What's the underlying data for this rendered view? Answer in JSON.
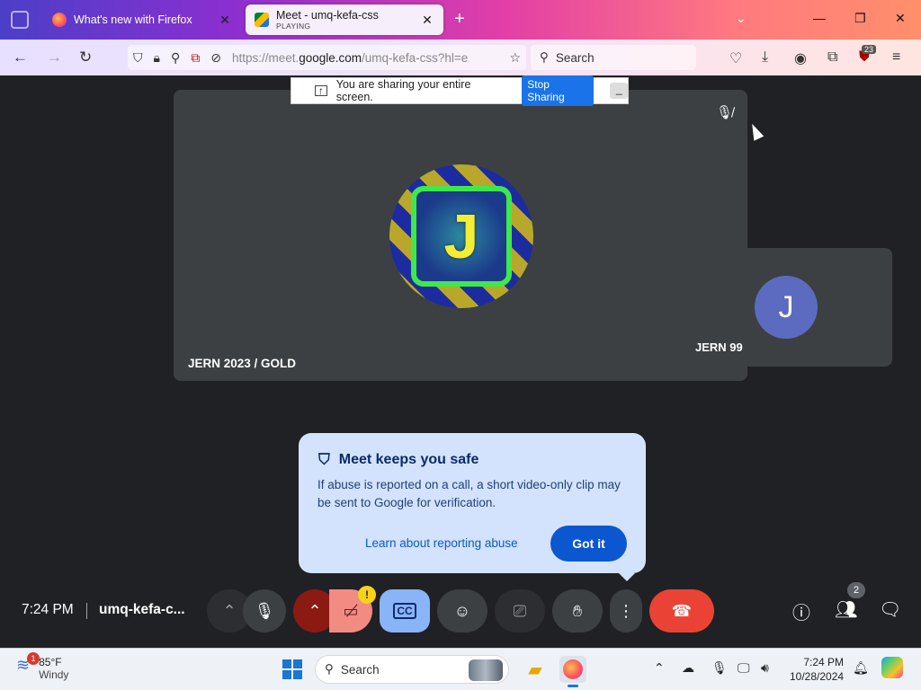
{
  "browser": {
    "tabs": [
      {
        "title": "What's new with Firefox",
        "subtitle": ""
      },
      {
        "title": "Meet - umq-kefa-css",
        "subtitle": "PLAYING"
      }
    ],
    "url_prefix": "https://meet.",
    "url_domain": "google.com",
    "url_rest": "/umq-kefa-css?hl=e",
    "search_placeholder": "Search",
    "extension_badge": "23"
  },
  "share_banner": {
    "text": "You are sharing your entire screen.",
    "stop_label": "Stop Sharing",
    "minimize_label": "_"
  },
  "meeting": {
    "main_tile_name": "JERN 2023 / GOLD",
    "main_avatar_letter": "J",
    "side_tile_name": "JERN 99",
    "side_avatar_letter": "J",
    "clock": "7:24 PM",
    "meeting_code": "umq-kefa-c...",
    "camera_warning": "!",
    "people_count": "2"
  },
  "safety_card": {
    "title": "Meet keeps you safe",
    "body": "If abuse is reported on a call, a short video-only clip may be sent to Google for verification.",
    "link": "Learn about reporting abuse",
    "button": "Got it"
  },
  "taskbar": {
    "weather_temp": "85°F",
    "weather_desc": "Windy",
    "weather_badge": "1",
    "search_placeholder": "Search",
    "time": "7:24 PM",
    "date": "10/28/2024"
  },
  "colors": {
    "meet_bg": "#202124",
    "tile_bg": "#3c4043",
    "end_call": "#ea4335",
    "card_bg": "#d3e3fd",
    "primary_blue": "#0b57d0"
  }
}
